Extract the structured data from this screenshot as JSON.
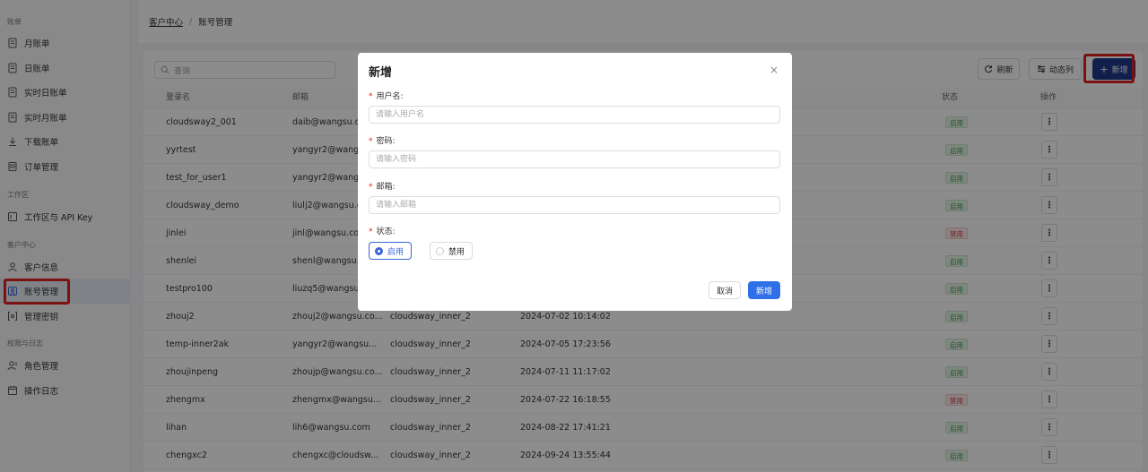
{
  "sidebar": {
    "groups": [
      {
        "title": "账单",
        "items": [
          {
            "label": "月账单",
            "icon": "document-icon"
          },
          {
            "label": "日账单",
            "icon": "document-icon"
          },
          {
            "label": "实时日账单",
            "icon": "document-icon"
          },
          {
            "label": "实时月账单",
            "icon": "document-icon"
          },
          {
            "label": "下载账单",
            "icon": "download-icon"
          },
          {
            "label": "订单管理",
            "icon": "order-icon"
          }
        ]
      },
      {
        "title": "工作区",
        "items": [
          {
            "label": "工作区与 API Key",
            "icon": "workspace-icon"
          }
        ]
      },
      {
        "title": "客户中心",
        "items": [
          {
            "label": "客户信息",
            "icon": "user-icon"
          },
          {
            "label": "账号管理",
            "icon": "account-icon",
            "active": true
          },
          {
            "label": "管理密钥",
            "icon": "key-icon"
          }
        ]
      },
      {
        "title": "权限与日志",
        "items": [
          {
            "label": "角色管理",
            "icon": "role-icon"
          },
          {
            "label": "操作日志",
            "icon": "log-icon"
          }
        ]
      }
    ]
  },
  "breadcrumb": {
    "parent": "客户中心",
    "separator": "/",
    "current": "账号管理"
  },
  "toolbar": {
    "search_placeholder": "查询",
    "refresh_label": "刷新",
    "columns_label": "动态列",
    "add_label": "新增"
  },
  "table": {
    "headers": [
      "登录名",
      "邮箱",
      "",
      "",
      "状态",
      "操作"
    ],
    "rows": [
      {
        "login": "cloudsway2_001",
        "email": "daib@wangsu.com",
        "workspace": "",
        "created": "",
        "status": "启用",
        "status_type": "on"
      },
      {
        "login": "yyrtest",
        "email": "yangyr2@wangsu.com",
        "workspace": "",
        "created": "",
        "status": "启用",
        "status_type": "on"
      },
      {
        "login": "test_for_user1",
        "email": "yangyr2@wangsu.com",
        "workspace": "",
        "created": "",
        "status": "启用",
        "status_type": "on"
      },
      {
        "login": "cloudsway_demo",
        "email": "liulj2@wangsu.com",
        "workspace": "",
        "created": "",
        "status": "启用",
        "status_type": "on"
      },
      {
        "login": "jinlei",
        "email": "jinl@wangsu.com",
        "workspace": "",
        "created": "",
        "status": "禁用",
        "status_type": "off"
      },
      {
        "login": "shenlei",
        "email": "shenl@wangsu.com",
        "workspace": "",
        "created": "",
        "status": "启用",
        "status_type": "on"
      },
      {
        "login": "testpro100",
        "email": "liuzq5@wangsu.com",
        "workspace": "",
        "created": "",
        "status": "启用",
        "status_type": "on"
      },
      {
        "login": "zhouj2",
        "email": "zhouj2@wangsu.co...",
        "workspace": "cloudsway_inner_2",
        "created": "2024-07-02 10:14:02",
        "status": "启用",
        "status_type": "on"
      },
      {
        "login": "temp-inner2ak",
        "email": "yangyr2@wangsu...",
        "workspace": "cloudsway_inner_2",
        "created": "2024-07-05 17:23:56",
        "status": "启用",
        "status_type": "on"
      },
      {
        "login": "zhoujinpeng",
        "email": "zhoujp@wangsu.co...",
        "workspace": "cloudsway_inner_2",
        "created": "2024-07-11 11:17:02",
        "status": "启用",
        "status_type": "on"
      },
      {
        "login": "zhengmx",
        "email": "zhengmx@wangsu...",
        "workspace": "cloudsway_inner_2",
        "created": "2024-07-22 16:18:55",
        "status": "禁用",
        "status_type": "off"
      },
      {
        "login": "lihan",
        "email": "lih6@wangsu.com",
        "workspace": "cloudsway_inner_2",
        "created": "2024-08-22 17:41:21",
        "status": "启用",
        "status_type": "on"
      },
      {
        "login": "chengxc2",
        "email": "chengxc@cloudsw...",
        "workspace": "cloudsway_inner_2",
        "created": "2024-09-24 13:55:44",
        "status": "启用",
        "status_type": "on"
      }
    ],
    "op_label": "⋮"
  },
  "modal": {
    "title": "新增",
    "close": "×",
    "fields": {
      "username": {
        "label": "用户名:",
        "placeholder": "请输入用户名"
      },
      "password": {
        "label": "密码:",
        "placeholder": "请输入密码"
      },
      "email": {
        "label": "邮箱:",
        "placeholder": "请输入邮箱"
      },
      "status": {
        "label": "状态:"
      }
    },
    "required_mark": "*",
    "status_options": [
      "启用",
      "禁用"
    ],
    "status_selected": "启用",
    "cancel_label": "取消",
    "submit_label": "新增"
  },
  "colors": {
    "primary": "#2f6fe8",
    "add_button": "#1f3a8a",
    "highlight": "#e02020",
    "enabled": "#3a9b4a",
    "disabled": "#d9363e"
  }
}
